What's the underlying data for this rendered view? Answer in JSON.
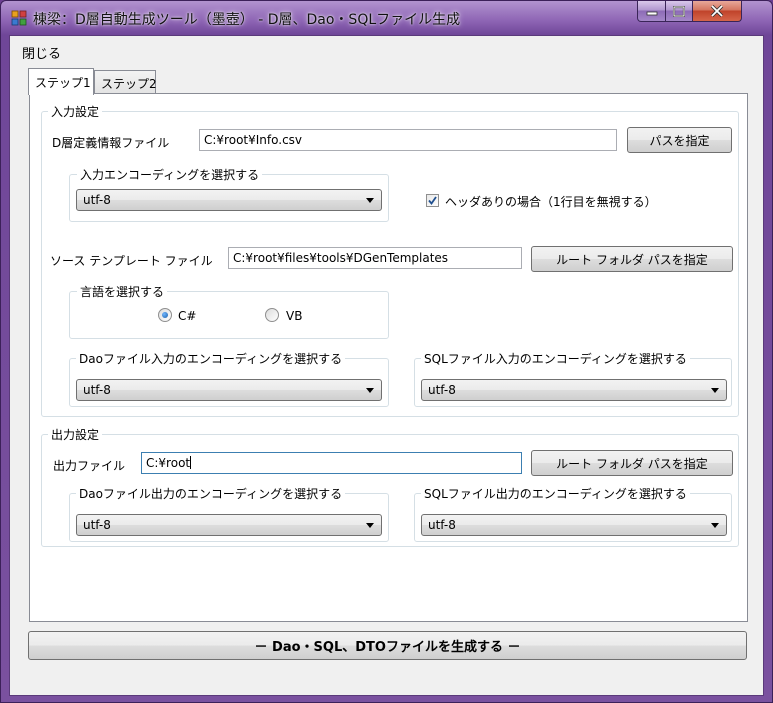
{
  "window": {
    "title": "棟梁：D層自動生成ツール（墨壺） - D層、Dao・SQLファイル生成"
  },
  "menu": {
    "close_label": "閉じる"
  },
  "tabs": [
    {
      "label": "ステップ1",
      "active": true
    },
    {
      "label": "ステップ2",
      "active": false
    }
  ],
  "input_settings": {
    "legend": "入力設定",
    "dlayer_file_label": "D層定義情報ファイル",
    "dlayer_file_value": "C:¥root¥Info.csv",
    "path_button_label": "パスを指定",
    "input_encoding_legend": "入力エンコーディングを選択する",
    "input_encoding_value": "utf-8",
    "header_checkbox_label": "ヘッダありの場合（1行目を無視する）",
    "header_checkbox_checked": true,
    "template_label": "ソース テンプレート ファイル",
    "template_value": "C:¥root¥files¥tools¥DGenTemplates",
    "template_button_label": "ルート フォルダ パスを指定",
    "language_legend": "言語を選択する",
    "language_options": [
      {
        "label": "C#",
        "checked": true
      },
      {
        "label": "VB",
        "checked": false
      }
    ],
    "dao_input_encoding_legend": "Daoファイル入力のエンコーディングを選択する",
    "dao_input_encoding_value": "utf-8",
    "sql_input_encoding_legend": "SQLファイル入力のエンコーディングを選択する",
    "sql_input_encoding_value": "utf-8"
  },
  "output_settings": {
    "legend": "出力設定",
    "output_file_label": "出力ファイル",
    "output_file_value": "C:¥root",
    "output_button_label": "ルート フォルダ パスを指定",
    "dao_output_encoding_legend": "Daoファイル出力のエンコーディングを選択する",
    "dao_output_encoding_value": "utf-8",
    "sql_output_encoding_legend": "SQLファイル出力のエンコーディングを選択する",
    "sql_output_encoding_value": "utf-8"
  },
  "generate_button_label": "－ Dao・SQL、DTOファイルを生成する －",
  "colors": {
    "title_bar": "#8d64b4",
    "client_background": "#f0f0f0",
    "panel_background": "#ffffff",
    "radio_accent": "#1c5fa8"
  }
}
